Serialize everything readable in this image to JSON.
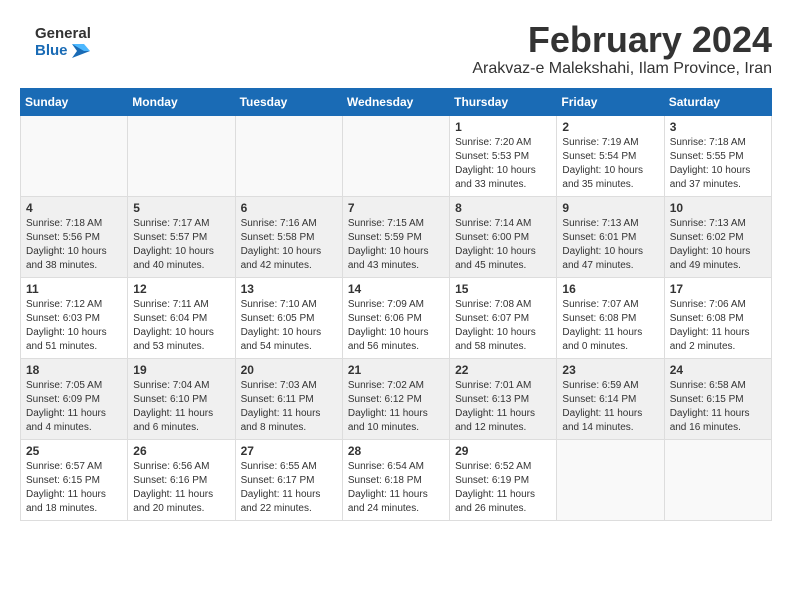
{
  "logo": {
    "general": "General",
    "blue": "Blue"
  },
  "title": "February 2024",
  "subtitle": "Arakvaz-e Malekshahi, Ilam Province, Iran",
  "headers": [
    "Sunday",
    "Monday",
    "Tuesday",
    "Wednesday",
    "Thursday",
    "Friday",
    "Saturday"
  ],
  "weeks": [
    [
      {
        "day": "",
        "info": ""
      },
      {
        "day": "",
        "info": ""
      },
      {
        "day": "",
        "info": ""
      },
      {
        "day": "",
        "info": ""
      },
      {
        "day": "1",
        "info": "Sunrise: 7:20 AM\nSunset: 5:53 PM\nDaylight: 10 hours\nand 33 minutes."
      },
      {
        "day": "2",
        "info": "Sunrise: 7:19 AM\nSunset: 5:54 PM\nDaylight: 10 hours\nand 35 minutes."
      },
      {
        "day": "3",
        "info": "Sunrise: 7:18 AM\nSunset: 5:55 PM\nDaylight: 10 hours\nand 37 minutes."
      }
    ],
    [
      {
        "day": "4",
        "info": "Sunrise: 7:18 AM\nSunset: 5:56 PM\nDaylight: 10 hours\nand 38 minutes."
      },
      {
        "day": "5",
        "info": "Sunrise: 7:17 AM\nSunset: 5:57 PM\nDaylight: 10 hours\nand 40 minutes."
      },
      {
        "day": "6",
        "info": "Sunrise: 7:16 AM\nSunset: 5:58 PM\nDaylight: 10 hours\nand 42 minutes."
      },
      {
        "day": "7",
        "info": "Sunrise: 7:15 AM\nSunset: 5:59 PM\nDaylight: 10 hours\nand 43 minutes."
      },
      {
        "day": "8",
        "info": "Sunrise: 7:14 AM\nSunset: 6:00 PM\nDaylight: 10 hours\nand 45 minutes."
      },
      {
        "day": "9",
        "info": "Sunrise: 7:13 AM\nSunset: 6:01 PM\nDaylight: 10 hours\nand 47 minutes."
      },
      {
        "day": "10",
        "info": "Sunrise: 7:13 AM\nSunset: 6:02 PM\nDaylight: 10 hours\nand 49 minutes."
      }
    ],
    [
      {
        "day": "11",
        "info": "Sunrise: 7:12 AM\nSunset: 6:03 PM\nDaylight: 10 hours\nand 51 minutes."
      },
      {
        "day": "12",
        "info": "Sunrise: 7:11 AM\nSunset: 6:04 PM\nDaylight: 10 hours\nand 53 minutes."
      },
      {
        "day": "13",
        "info": "Sunrise: 7:10 AM\nSunset: 6:05 PM\nDaylight: 10 hours\nand 54 minutes."
      },
      {
        "day": "14",
        "info": "Sunrise: 7:09 AM\nSunset: 6:06 PM\nDaylight: 10 hours\nand 56 minutes."
      },
      {
        "day": "15",
        "info": "Sunrise: 7:08 AM\nSunset: 6:07 PM\nDaylight: 10 hours\nand 58 minutes."
      },
      {
        "day": "16",
        "info": "Sunrise: 7:07 AM\nSunset: 6:08 PM\nDaylight: 11 hours\nand 0 minutes."
      },
      {
        "day": "17",
        "info": "Sunrise: 7:06 AM\nSunset: 6:08 PM\nDaylight: 11 hours\nand 2 minutes."
      }
    ],
    [
      {
        "day": "18",
        "info": "Sunrise: 7:05 AM\nSunset: 6:09 PM\nDaylight: 11 hours\nand 4 minutes."
      },
      {
        "day": "19",
        "info": "Sunrise: 7:04 AM\nSunset: 6:10 PM\nDaylight: 11 hours\nand 6 minutes."
      },
      {
        "day": "20",
        "info": "Sunrise: 7:03 AM\nSunset: 6:11 PM\nDaylight: 11 hours\nand 8 minutes."
      },
      {
        "day": "21",
        "info": "Sunrise: 7:02 AM\nSunset: 6:12 PM\nDaylight: 11 hours\nand 10 minutes."
      },
      {
        "day": "22",
        "info": "Sunrise: 7:01 AM\nSunset: 6:13 PM\nDaylight: 11 hours\nand 12 minutes."
      },
      {
        "day": "23",
        "info": "Sunrise: 6:59 AM\nSunset: 6:14 PM\nDaylight: 11 hours\nand 14 minutes."
      },
      {
        "day": "24",
        "info": "Sunrise: 6:58 AM\nSunset: 6:15 PM\nDaylight: 11 hours\nand 16 minutes."
      }
    ],
    [
      {
        "day": "25",
        "info": "Sunrise: 6:57 AM\nSunset: 6:15 PM\nDaylight: 11 hours\nand 18 minutes."
      },
      {
        "day": "26",
        "info": "Sunrise: 6:56 AM\nSunset: 6:16 PM\nDaylight: 11 hours\nand 20 minutes."
      },
      {
        "day": "27",
        "info": "Sunrise: 6:55 AM\nSunset: 6:17 PM\nDaylight: 11 hours\nand 22 minutes."
      },
      {
        "day": "28",
        "info": "Sunrise: 6:54 AM\nSunset: 6:18 PM\nDaylight: 11 hours\nand 24 minutes."
      },
      {
        "day": "29",
        "info": "Sunrise: 6:52 AM\nSunset: 6:19 PM\nDaylight: 11 hours\nand 26 minutes."
      },
      {
        "day": "",
        "info": ""
      },
      {
        "day": "",
        "info": ""
      }
    ]
  ]
}
